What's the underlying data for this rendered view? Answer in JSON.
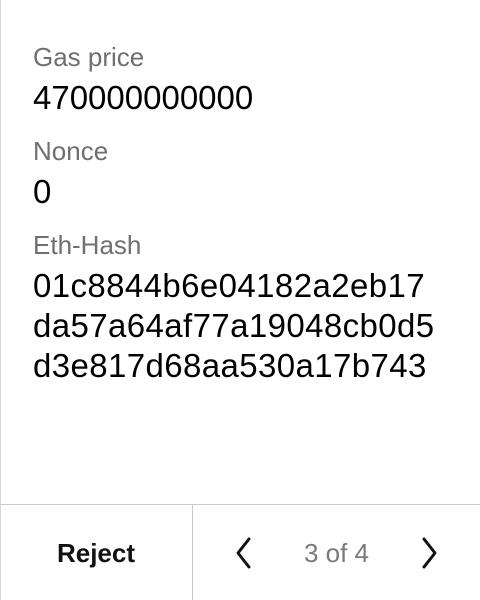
{
  "fields": [
    {
      "label": "Gas price",
      "value": "470000000000"
    },
    {
      "label": "Nonce",
      "value": "0"
    },
    {
      "label": "Eth-Hash",
      "value": "01c8844b6e04182a2eb17da57a64af77a19048cb0d5d3e817d68aa530a17b743"
    }
  ],
  "footer": {
    "reject_label": "Reject",
    "page_indicator": "3 of 4",
    "prev_icon": "chevron-left-icon",
    "next_icon": "chevron-right-icon"
  },
  "colors": {
    "label": "#6f6f6f",
    "value": "#000000",
    "divider": "#c9c9c9"
  }
}
